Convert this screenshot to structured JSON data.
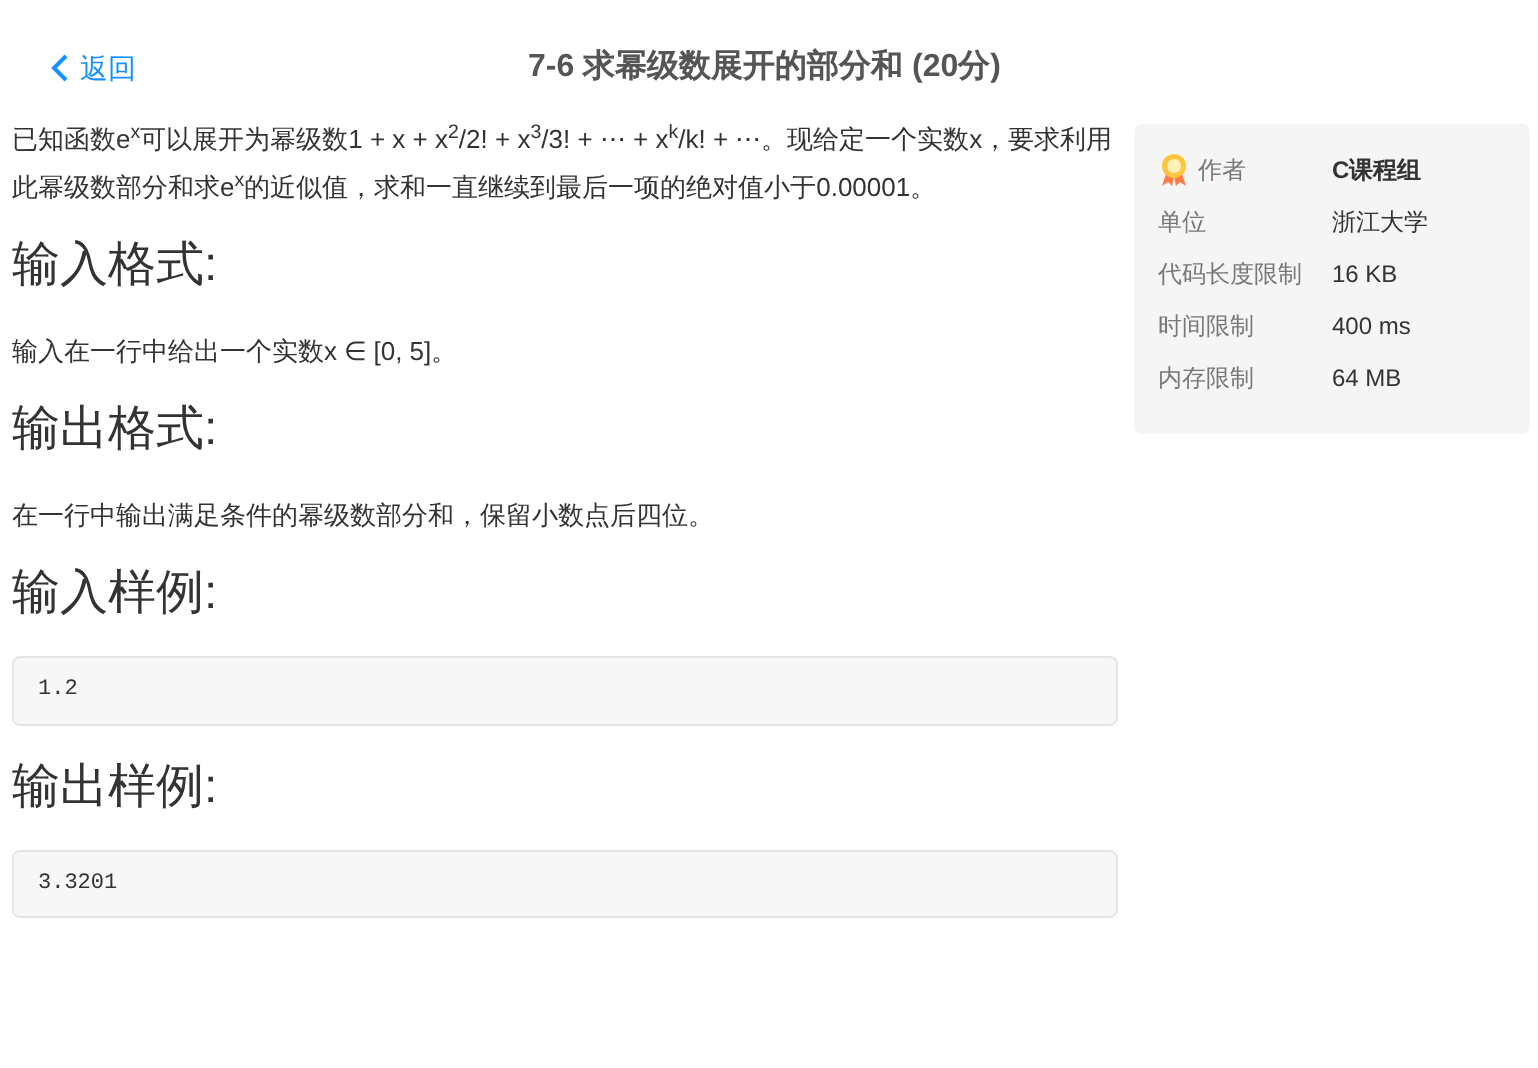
{
  "header": {
    "back": "返回",
    "title": "7-6 求幂级数展开的部分和 (20分)"
  },
  "sections": [
    {
      "kind": "paragraph",
      "text": "已知函数e$^{x}$可以展开为幂级数1 + x + x$^{2}$/2! + x$^{3}$/3! + ⋯ + x$^{k}$/k! + ⋯。现给定一个实数x，要求利用此幂级数部分和求e$^{x}$的近似值，求和一直继续到最后一项的绝对值小于0.00001。"
    },
    {
      "kind": "heading",
      "text": "输入格式:"
    },
    {
      "kind": "paragraph",
      "text": "输入在一行中给出一个实数x ∈ [0, 5]。"
    },
    {
      "kind": "heading",
      "text": "输出格式:"
    },
    {
      "kind": "paragraph",
      "text": "在一行中输出满足条件的幂级数部分和，保留小数点后四位。"
    },
    {
      "kind": "heading",
      "text": "输入样例:"
    },
    {
      "kind": "code",
      "text": "1.2"
    },
    {
      "kind": "heading",
      "text": "输出样例:"
    },
    {
      "kind": "code",
      "text": "3.3201"
    }
  ],
  "info": [
    {
      "label": "作者",
      "value": "C课程组",
      "kind": "author"
    },
    {
      "label": "单位",
      "value": "浙江大学"
    },
    {
      "label": "代码长度限制",
      "value": "16 KB"
    },
    {
      "label": "时间限制",
      "value": "400 ms"
    },
    {
      "label": "内存限制",
      "value": "64 MB"
    }
  ]
}
